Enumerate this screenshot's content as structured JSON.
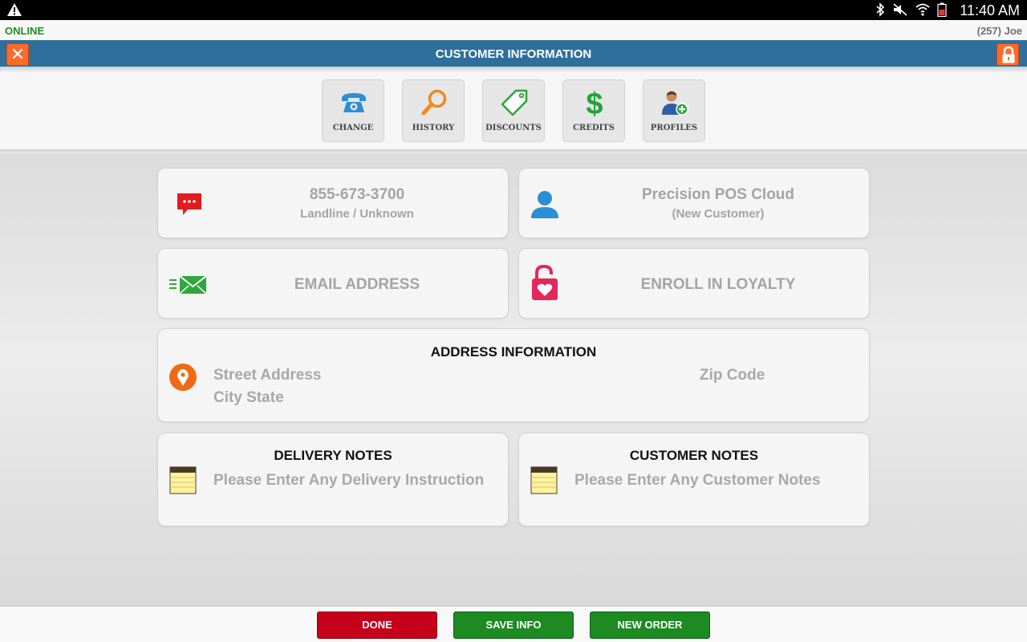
{
  "status_bar": {
    "time": "11:40 AM"
  },
  "info_bar": {
    "online_label": "ONLINE",
    "user_label": "(257) Joe"
  },
  "header": {
    "title": "CUSTOMER INFORMATION"
  },
  "toolbar": {
    "buttons": [
      {
        "label": "CHANGE",
        "icon": "phone-icon"
      },
      {
        "label": "HISTORY",
        "icon": "magnifier-icon"
      },
      {
        "label": "DISCOUNTS",
        "icon": "tag-icon"
      },
      {
        "label": "CREDITS",
        "icon": "dollar-icon"
      },
      {
        "label": "PROFILES",
        "icon": "add-profile-icon"
      }
    ]
  },
  "phone_card": {
    "number": "855-673-3700",
    "type": "Landline / Unknown"
  },
  "customer_card": {
    "name": "Precision POS Cloud",
    "status": "(New Customer)"
  },
  "email_card": {
    "label": "EMAIL ADDRESS"
  },
  "loyalty_card": {
    "label": "ENROLL IN LOYALTY"
  },
  "address_card": {
    "heading": "ADDRESS INFORMATION",
    "street": "Street Address",
    "city_state": "City State",
    "zip": "Zip Code"
  },
  "delivery_notes": {
    "heading": "DELIVERY NOTES",
    "placeholder": "Please Enter Any Delivery Instruction"
  },
  "customer_notes": {
    "heading": "CUSTOMER NOTES",
    "placeholder": "Please Enter Any Customer Notes"
  },
  "actions": {
    "done": "DONE",
    "save": "SAVE INFO",
    "new_order": "NEW ORDER"
  },
  "colors": {
    "header_bg": "#2f6f9b",
    "accent_orange": "#ff6a2b",
    "done_red": "#c4001b",
    "action_green": "#1e8a22",
    "online_green": "#1f8a1f"
  }
}
